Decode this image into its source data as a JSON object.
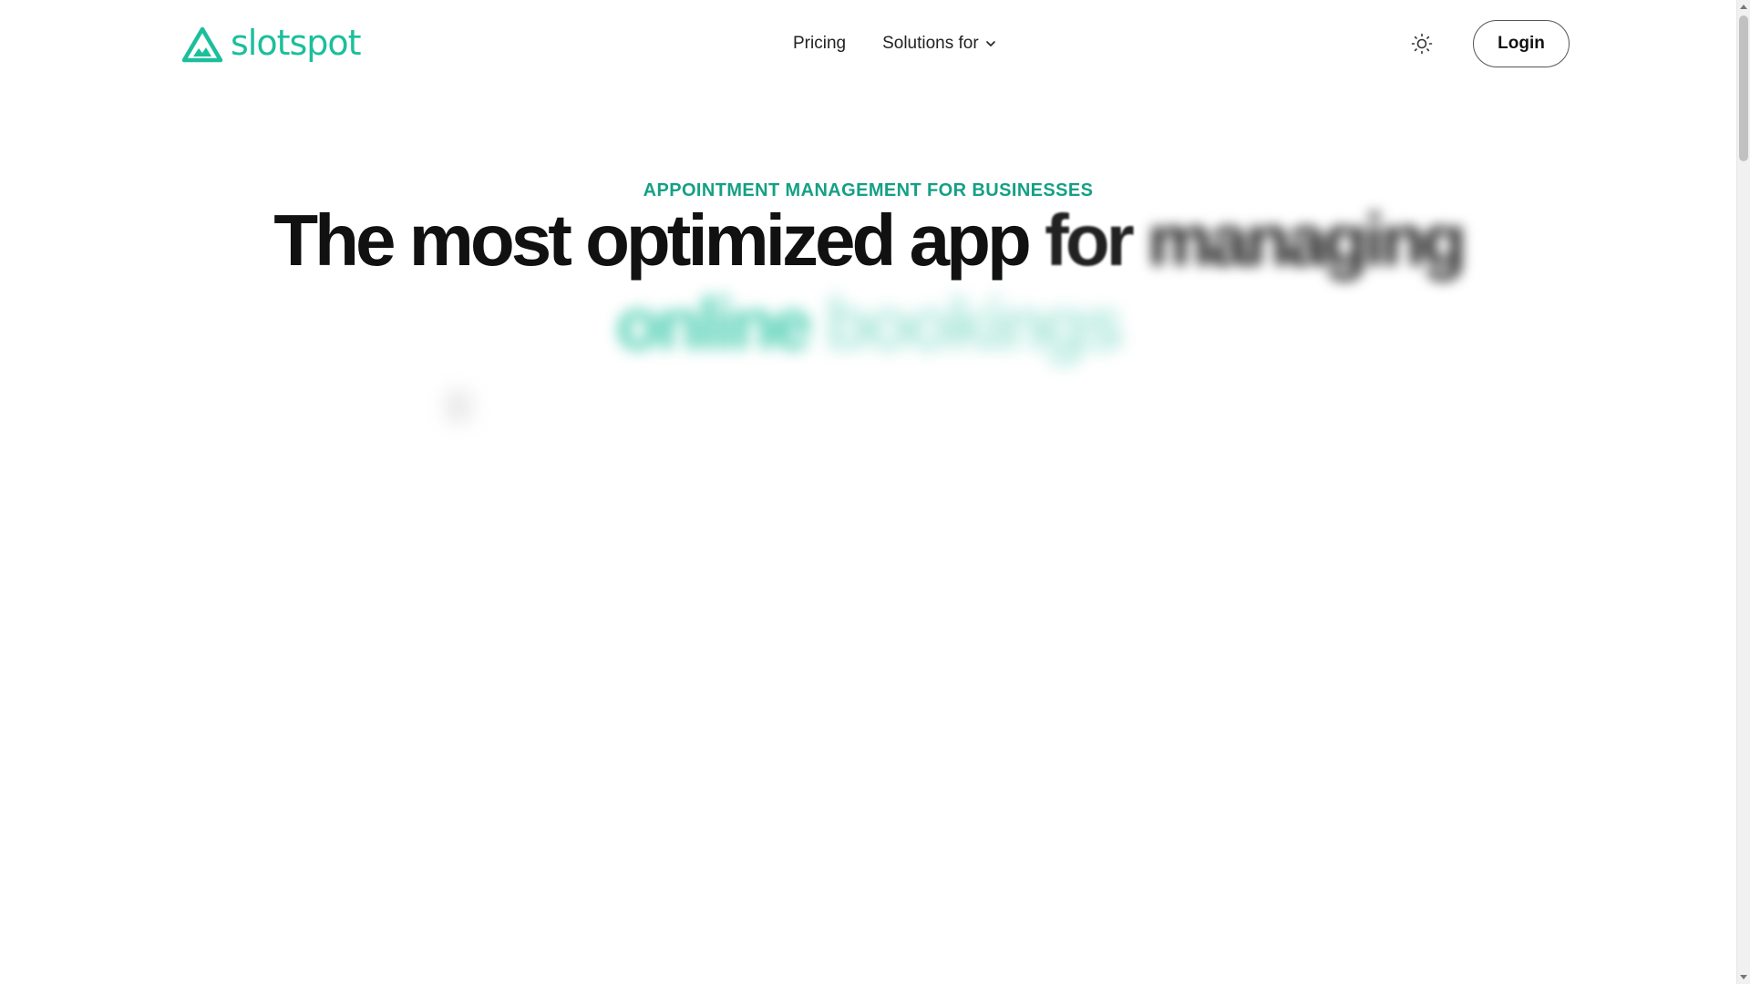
{
  "header": {
    "logo_text": "slotspot",
    "nav": {
      "pricing_label": "Pricing",
      "solutions_label": "Solutions for"
    },
    "login_label": "Login"
  },
  "hero": {
    "eyebrow": "APPOINTMENT MANAGEMENT FOR BUSINESSES",
    "headline_part1": "The most optimized app ",
    "headline_part2": "for ",
    "headline_part3": "managing",
    "headline_part4": "online ",
    "headline_part5": "bookings"
  },
  "colors": {
    "brand": "#1bbf9c",
    "eyebrow": "#15a085",
    "text": "#111111"
  },
  "icons": {
    "logo": "triangle-mountain-icon",
    "chevron": "chevron-down-icon",
    "theme": "sun-icon"
  }
}
